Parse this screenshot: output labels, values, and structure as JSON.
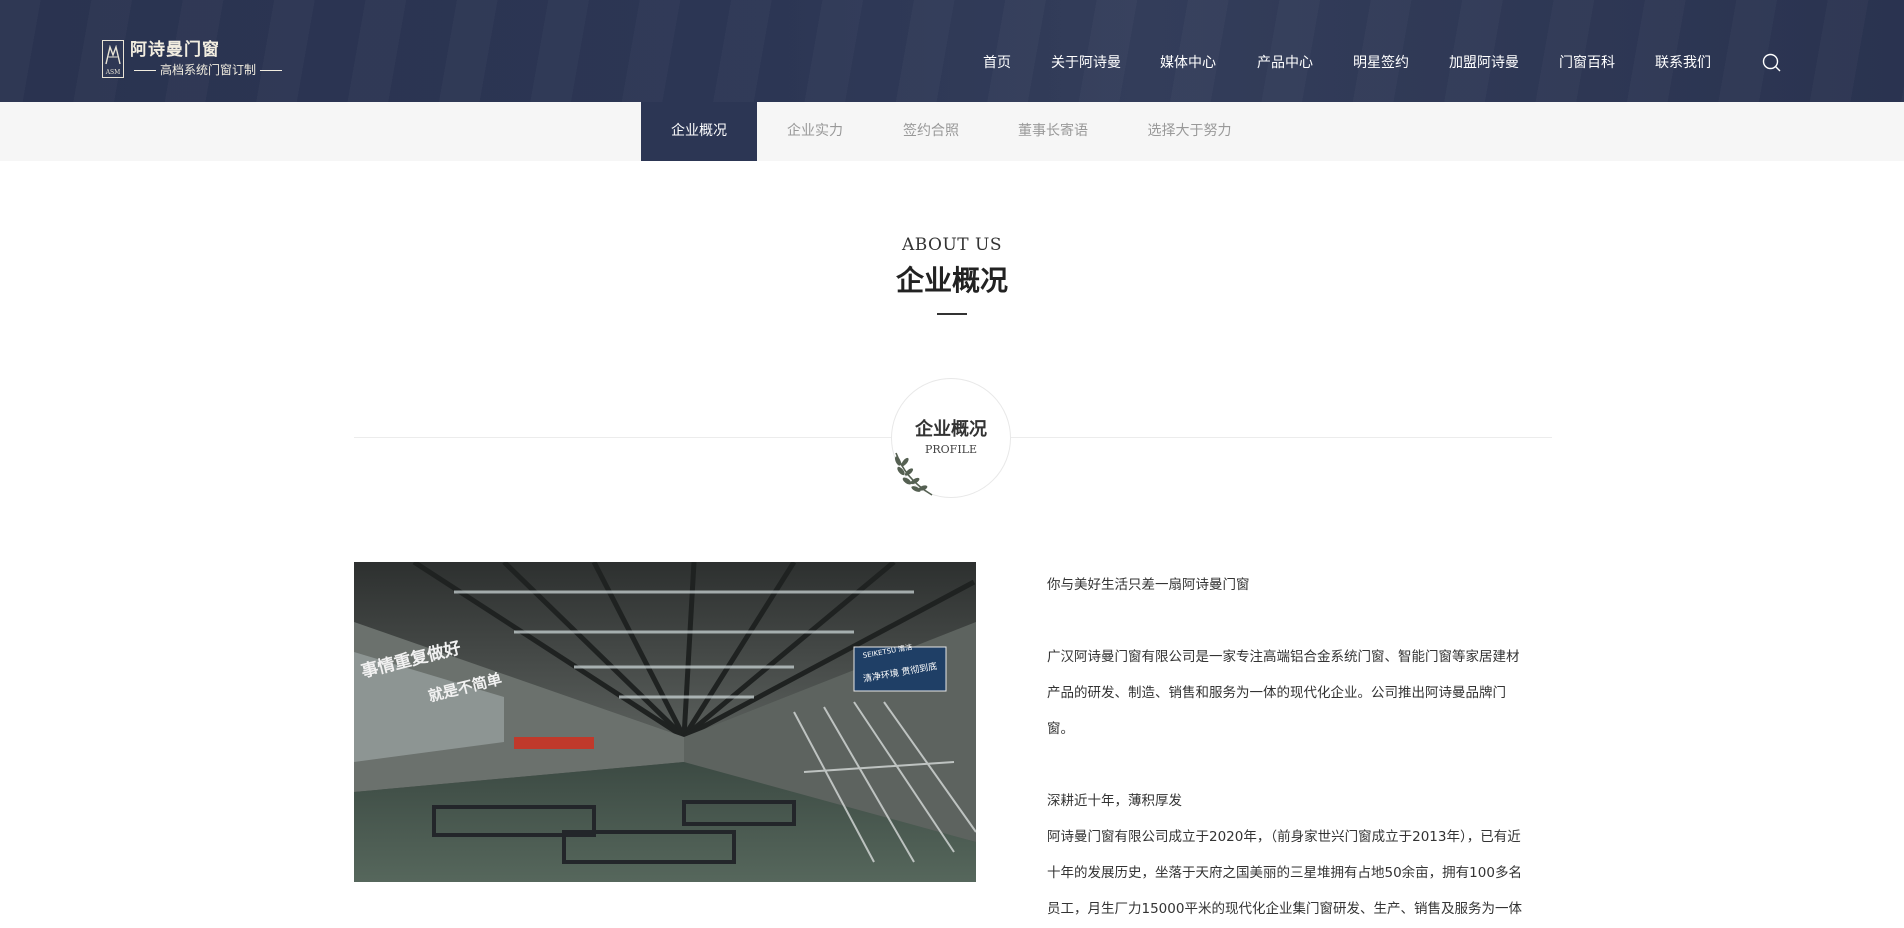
{
  "brand": {
    "title": "阿诗曼门窗",
    "subtitle": "高档系统门窗订制",
    "mark_letters": "ASM"
  },
  "nav": {
    "items": [
      "首页",
      "关于阿诗曼",
      "媒体中心",
      "产品中心",
      "明星签约",
      "加盟阿诗曼",
      "门窗百科",
      "联系我们"
    ],
    "search_icon": "search-icon"
  },
  "subnav": {
    "items": [
      "企业概况",
      "企业实力",
      "签约合照",
      "董事长寄语",
      "选择大于努力"
    ],
    "active_index": 0
  },
  "section": {
    "en_title": "ABOUT US",
    "cn_title": "企业概况"
  },
  "badge": {
    "cn": "企业概况",
    "en": "PROFILE",
    "icon": "laurel-icon"
  },
  "photo": {
    "sign_left_1": "事情重复做好",
    "sign_left_2": "就是不简单",
    "sign_right_1": "SEIKETSU 清洁",
    "sign_right_2": "清净环境 贯彻到底"
  },
  "content": {
    "p1": "你与美好生活只差一扇阿诗曼门窗",
    "p2_lines": [
      "广汉阿诗曼门窗有限公司是一家专注高端铝合金系统门窗、智能门窗等家居建材",
      "产品的研发、制造、销售和服务为一体的现代化企业。公司推出阿诗曼品牌门",
      "窗。"
    ],
    "p3": "深耕近十年，薄积厚发",
    "p4_lines": [
      "阿诗曼门窗有限公司成立于2020年，（前身家世兴门窗成立于2013年），已有近",
      "十年的发展历史，坐落于天府之国美丽的三星堆拥有占地50余亩，拥有100多名",
      "员工，月生厂力15000平米的现代化企业集门窗研发、生产、销售及服务为一体"
    ]
  },
  "colors": {
    "header_bg": "#2c3654",
    "subnav_bg": "#f6f6f6",
    "active_tab_bg": "#2c3654",
    "inactive_tab_text": "#999999"
  }
}
